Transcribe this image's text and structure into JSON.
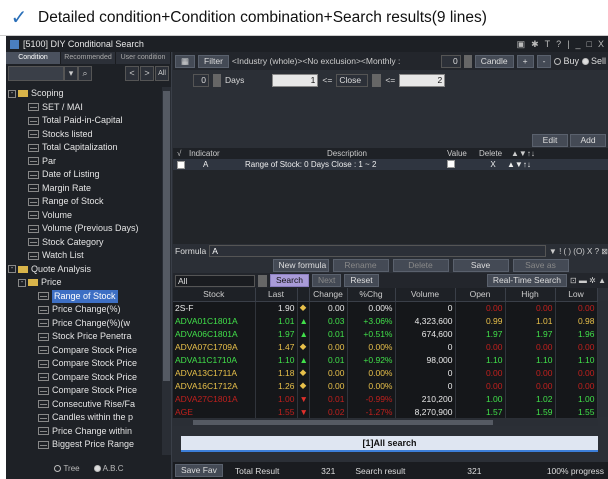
{
  "caption": {
    "check": "✓",
    "text": "Detailed condition+Condition combination+Search results(9 lines)"
  },
  "window": {
    "title": "[5100] DIY Conditional Search",
    "controls": [
      "▣",
      "✱",
      "T",
      "?",
      "|",
      "_",
      "□",
      "X"
    ]
  },
  "left_panel": {
    "tabs": [
      "Condition",
      "Recommended",
      "User condition"
    ],
    "nav_prev": "<",
    "nav_next": ">",
    "nav_all": "All",
    "tree": [
      {
        "label": "Scoping",
        "type": "folder",
        "toggle": "-",
        "indent": 0
      },
      {
        "label": "SET / MAI",
        "type": "leaf",
        "indent": 2
      },
      {
        "label": "Total Paid-in-Capital",
        "type": "leaf",
        "indent": 2
      },
      {
        "label": "Stocks listed",
        "type": "leaf",
        "indent": 2
      },
      {
        "label": "Total Capitalization",
        "type": "leaf",
        "indent": 2
      },
      {
        "label": "Par",
        "type": "leaf",
        "indent": 2
      },
      {
        "label": "Date of Listing",
        "type": "leaf",
        "indent": 2
      },
      {
        "label": "Margin Rate",
        "type": "leaf",
        "indent": 2
      },
      {
        "label": "Range of Stock",
        "type": "leaf",
        "indent": 2
      },
      {
        "label": "Volume",
        "type": "leaf",
        "indent": 2
      },
      {
        "label": "Volume (Previous Days)",
        "type": "leaf",
        "indent": 2
      },
      {
        "label": "Stock Category",
        "type": "leaf",
        "indent": 2
      },
      {
        "label": "Watch List",
        "type": "leaf",
        "indent": 2
      },
      {
        "label": "Quote Analysis",
        "type": "folder",
        "toggle": "-",
        "indent": 0
      },
      {
        "label": "Price",
        "type": "folder",
        "toggle": "-",
        "indent": 1
      },
      {
        "label": "Range of Stock",
        "type": "leaf",
        "indent": 3,
        "selected": true
      },
      {
        "label": "Price Change(%)",
        "type": "leaf",
        "indent": 3
      },
      {
        "label": "Price Change(%)(w",
        "type": "leaf",
        "indent": 3
      },
      {
        "label": "Stock Price Penetra",
        "type": "leaf",
        "indent": 3
      },
      {
        "label": "Compare Stock Price",
        "type": "leaf",
        "indent": 3
      },
      {
        "label": "Compare Stock Price",
        "type": "leaf",
        "indent": 3
      },
      {
        "label": "Compare Stock Price",
        "type": "leaf",
        "indent": 3
      },
      {
        "label": "Compare Stock Price",
        "type": "leaf",
        "indent": 3
      },
      {
        "label": "Consecutive Rise/Fa",
        "type": "leaf",
        "indent": 3
      },
      {
        "label": "Candles within the p",
        "type": "leaf",
        "indent": 3
      },
      {
        "label": "Price Change within",
        "type": "leaf",
        "indent": 3
      },
      {
        "label": "Biggest Price Range",
        "type": "leaf",
        "indent": 3
      }
    ],
    "radio_tree": "Tree",
    "radio_abc": "A.B.C"
  },
  "toolbar": {
    "filter": "Filter",
    "condition_text": "<Industry (whole)><No exclusion><Monthly :",
    "count": "0",
    "candle": "Candle",
    "plus": "+",
    "minus": "-",
    "buy": "Buy",
    "sell": "Sell"
  },
  "days_row": {
    "days_value": "0",
    "days_label": "Days",
    "from_value": "1",
    "op1": "<=",
    "field": "Close",
    "op2": "<=",
    "to_value": "2"
  },
  "edit_buttons": {
    "edit": "Edit",
    "add": "Add"
  },
  "indicator_table": {
    "headers": {
      "check": "√",
      "indicator": "Indicator",
      "description": "Description",
      "value": "Value",
      "delete": "Delete",
      "arrows": "▲▼↑↓"
    },
    "rows": [
      {
        "indicator": "A",
        "description": "Range of Stock: 0 Days Close : 1 ~ 2",
        "delete": "X",
        "arrows": "▲▼↑↓"
      }
    ]
  },
  "formula": {
    "label": "Formula",
    "value": "A",
    "ops": "▼ ! ( ) (O) X ? ⊠"
  },
  "formula_buttons": [
    "New formula",
    "Rename",
    "Delete",
    "Save",
    "Save as"
  ],
  "search_bar": {
    "scope": "All",
    "search": "Search",
    "next": "Next",
    "reset": "Reset",
    "realtime": "Real-Time Search",
    "icons": "⊡ ▬ ✲ ▲"
  },
  "results": {
    "columns": [
      "Stock",
      "Last",
      "",
      "Change",
      "%Chg",
      "Volume",
      "Open",
      "High",
      "Low"
    ],
    "rows": [
      {
        "stock": "2S-F",
        "last": "1.90",
        "arrow": "◆",
        "change": "0.00",
        "pct": "0.00%",
        "volume": "0",
        "open": "0.00",
        "high": "0.00",
        "low": "0.00",
        "color": "#e8e8e8",
        "arrow_color": "#e8c04a",
        "ohl_color": "#c0201d"
      },
      {
        "stock": "ADVA01C1801A",
        "last": "1.01",
        "arrow": "▲",
        "change": "0.03",
        "pct": "+3.06%",
        "volume": "4,323,600",
        "open": "0.99",
        "high": "1.01",
        "low": "0.98",
        "color": "#41e04a",
        "arrow_color": "#41e04a",
        "ohl_color": "#e8c04a"
      },
      {
        "stock": "ADVA06C1801A",
        "last": "1.97",
        "arrow": "▲",
        "change": "0.01",
        "pct": "+0.51%",
        "volume": "674,600",
        "open": "1.97",
        "high": "1.97",
        "low": "1.96",
        "color": "#41e04a",
        "arrow_color": "#41e04a",
        "ohl_color": "#41e04a"
      },
      {
        "stock": "ADVA07C1709A",
        "last": "1.47",
        "arrow": "◆",
        "change": "0.00",
        "pct": "0.00%",
        "volume": "0",
        "open": "0.00",
        "high": "0.00",
        "low": "0.00",
        "color": "#e8c04a",
        "arrow_color": "#e8c04a",
        "ohl_color": "#c0201d"
      },
      {
        "stock": "ADVA11C1710A",
        "last": "1.10",
        "arrow": "▲",
        "change": "0.01",
        "pct": "+0.92%",
        "volume": "98,000",
        "open": "1.10",
        "high": "1.10",
        "low": "1.10",
        "color": "#41e04a",
        "arrow_color": "#41e04a",
        "ohl_color": "#41e04a"
      },
      {
        "stock": "ADVA13C1711A",
        "last": "1.18",
        "arrow": "◆",
        "change": "0.00",
        "pct": "0.00%",
        "volume": "0",
        "open": "0.00",
        "high": "0.00",
        "low": "0.00",
        "color": "#e8c04a",
        "arrow_color": "#e8c04a",
        "ohl_color": "#c0201d"
      },
      {
        "stock": "ADVA16C1712A",
        "last": "1.26",
        "arrow": "◆",
        "change": "0.00",
        "pct": "0.00%",
        "volume": "0",
        "open": "0.00",
        "high": "0.00",
        "low": "0.00",
        "color": "#e8c04a",
        "arrow_color": "#e8c04a",
        "ohl_color": "#c0201d"
      },
      {
        "stock": "ADVA27C1801A",
        "last": "1.00",
        "arrow": "▼",
        "change": "0.01",
        "pct": "-0.99%",
        "volume": "210,200",
        "open": "1.00",
        "high": "1.02",
        "low": "1.00",
        "color": "#c0201d",
        "arrow_color": "#e0302b",
        "ohl_color": "#41e04a"
      },
      {
        "stock": "AGE",
        "last": "1.55",
        "arrow": "▼",
        "change": "0.02",
        "pct": "-1.27%",
        "volume": "8,270,900",
        "open": "1.57",
        "high": "1.59",
        "low": "1.55",
        "color": "#c0201d",
        "arrow_color": "#e0302b",
        "ohl_color": "#41e04a"
      }
    ]
  },
  "result_bar": "[1]All search",
  "status": {
    "save_fav": "Save Fav",
    "total_label": "Total Result",
    "total": "321",
    "search_label": "Search result",
    "search_count": "321",
    "progress": "100% progress"
  }
}
